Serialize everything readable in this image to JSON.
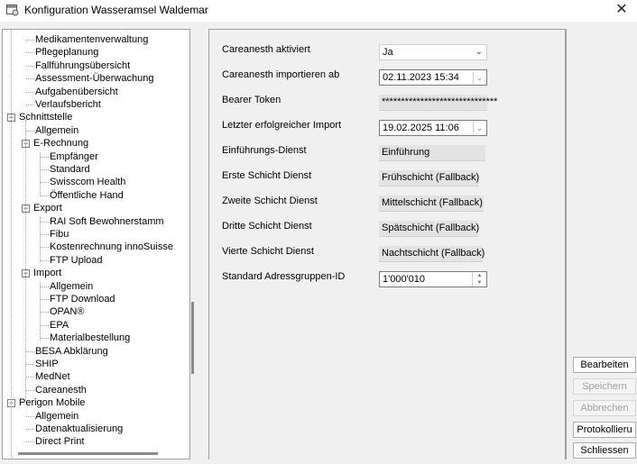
{
  "window": {
    "title": "Konfiguration Wasseramsel Waldemar",
    "close_glyph": "✕"
  },
  "tree": {
    "items": [
      {
        "label": "Medikamentenverwaltung",
        "level": 2
      },
      {
        "label": "Pflegeplanung",
        "level": 2
      },
      {
        "label": "Fallführungsübersicht",
        "level": 2
      },
      {
        "label": "Assessment-Überwachung",
        "level": 2
      },
      {
        "label": "Aufgabenübersicht",
        "level": 2
      },
      {
        "label": "Verlaufsbericht",
        "level": 2
      },
      {
        "label": "Schnittstelle",
        "level": 1,
        "expanded": true
      },
      {
        "label": "Allgemein",
        "level": 2
      },
      {
        "label": "E-Rechnung",
        "level": 2,
        "expanded": true
      },
      {
        "label": "Empfänger",
        "level": 3
      },
      {
        "label": "Standard",
        "level": 3
      },
      {
        "label": "Swisscom Health",
        "level": 3
      },
      {
        "label": "Öffentliche Hand",
        "level": 3
      },
      {
        "label": "Export",
        "level": 2,
        "expanded": true
      },
      {
        "label": "RAI Soft Bewohnerstamm",
        "level": 3
      },
      {
        "label": "Fibu",
        "level": 3
      },
      {
        "label": "Kostenrechnung innoSuisse",
        "level": 3
      },
      {
        "label": "FTP Upload",
        "level": 3
      },
      {
        "label": "Import",
        "level": 2,
        "expanded": true
      },
      {
        "label": "Allgemein",
        "level": 3
      },
      {
        "label": "FTP Download",
        "level": 3
      },
      {
        "label": "OPAN®",
        "level": 3
      },
      {
        "label": "EPA",
        "level": 3
      },
      {
        "label": "Materialbestellung",
        "level": 3
      },
      {
        "label": "BESA Abklärung",
        "level": 2
      },
      {
        "label": "SHIP",
        "level": 2
      },
      {
        "label": "MedNet",
        "level": 2
      },
      {
        "label": "Careanesth",
        "level": 2
      },
      {
        "label": "Perigon Mobile",
        "level": 1,
        "expanded": true
      },
      {
        "label": "Allgemein",
        "level": 2
      },
      {
        "label": "Datenaktualisierung",
        "level": 2
      },
      {
        "label": "Direct Print",
        "level": 2
      }
    ]
  },
  "form": {
    "fields": [
      {
        "label": "Careanesth aktiviert",
        "value": "Ja",
        "kind": "combo"
      },
      {
        "label": "Careanesth importieren ab",
        "value": "02.11.2023 15:34",
        "kind": "date"
      },
      {
        "label": "Bearer Token",
        "value": "******************************",
        "kind": "readonly"
      },
      {
        "label": "Letzter erfolgreicher Import",
        "value": "19.02.2025 11:06",
        "kind": "date"
      },
      {
        "label": "Einführungs-Dienst",
        "value": "Einführung",
        "kind": "readonly"
      },
      {
        "label": "Erste Schicht Dienst",
        "value": "Frühschicht (Fallback)",
        "kind": "readonly"
      },
      {
        "label": "Zweite Schicht Dienst",
        "value": "Mittelschicht (Fallback)",
        "kind": "readonly"
      },
      {
        "label": "Dritte Schicht Dienst",
        "value": "Spätschicht (Fallback)",
        "kind": "readonly"
      },
      {
        "label": "Vierte Schicht Dienst",
        "value": "Nachtschicht (Fallback)",
        "kind": "readonly"
      },
      {
        "label": "Standard Adressgruppen-ID",
        "value": "1'000'010",
        "kind": "spin"
      }
    ]
  },
  "buttons": {
    "edit": "Bearbeiten",
    "save": "Speichern",
    "cancel": "Abbrechen",
    "log": "Protokollieru",
    "close": "Schliessen"
  }
}
